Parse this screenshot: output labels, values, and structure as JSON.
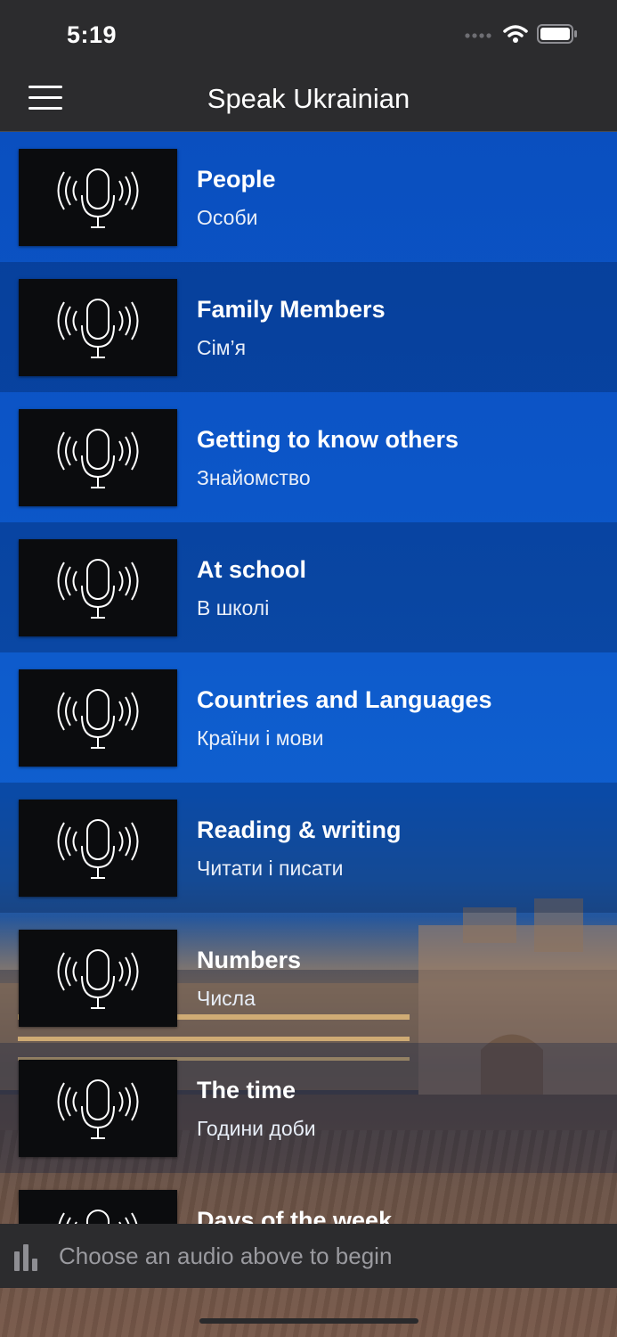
{
  "status_bar": {
    "time": "5:19"
  },
  "nav": {
    "title": "Speak Ukrainian",
    "menu_icon": "hamburger-menu-icon"
  },
  "topics": [
    {
      "title": "People",
      "subtitle": "Особи"
    },
    {
      "title": "Family Members",
      "subtitle": "Сім’я"
    },
    {
      "title": "Getting to know others",
      "subtitle": "Знайомство"
    },
    {
      "title": "At school",
      "subtitle": "В школі"
    },
    {
      "title": "Countries and Languages",
      "subtitle": "Країни і мови"
    },
    {
      "title": "Reading & writing",
      "subtitle": "Читати і писати"
    },
    {
      "title": "Numbers",
      "subtitle": "Числа"
    },
    {
      "title": "The time",
      "subtitle": "Години доби"
    },
    {
      "title": "Days of the week",
      "subtitle": ""
    }
  ],
  "player": {
    "text": "Choose an audio above to begin",
    "icon": "audio-bars-icon"
  },
  "colors": {
    "accent": "#0c56c8",
    "bar": "#2c2c2e"
  }
}
